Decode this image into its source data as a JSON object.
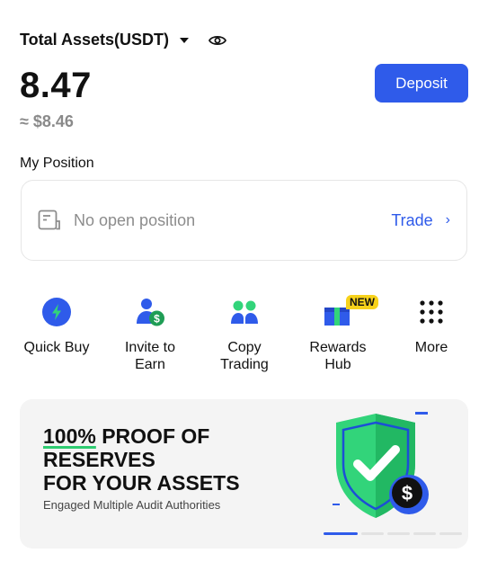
{
  "assets": {
    "title": "Total Assets(USDT)",
    "balance": "8.47",
    "approx": "≈ $8.46"
  },
  "deposit_label": "Deposit",
  "position": {
    "heading": "My Position",
    "empty_text": "No open position",
    "trade_label": "Trade",
    "trade_chevron": "›"
  },
  "quick_actions": [
    {
      "label": "Quick Buy",
      "icon": "lightning-icon"
    },
    {
      "label": "Invite to\nEarn",
      "icon": "invite-dollar-icon"
    },
    {
      "label": "Copy\nTrading",
      "icon": "copy-trading-icon"
    },
    {
      "label": "Rewards\nHub",
      "icon": "gift-icon",
      "badge": "NEW"
    },
    {
      "label": "More",
      "icon": "grid-dots-icon"
    }
  ],
  "banner": {
    "title_highlight": "100%",
    "title_rest_1": " PROOF OF",
    "title_line_2": "RESERVES",
    "title_line_3": "FOR YOUR ASSETS",
    "subtitle": "Engaged Multiple Audit Authorities",
    "carousel": {
      "total": 5,
      "active": 1
    }
  },
  "colors": {
    "accent": "#2f5bea",
    "green": "#2ecc71",
    "badge": "#f7d21b"
  }
}
